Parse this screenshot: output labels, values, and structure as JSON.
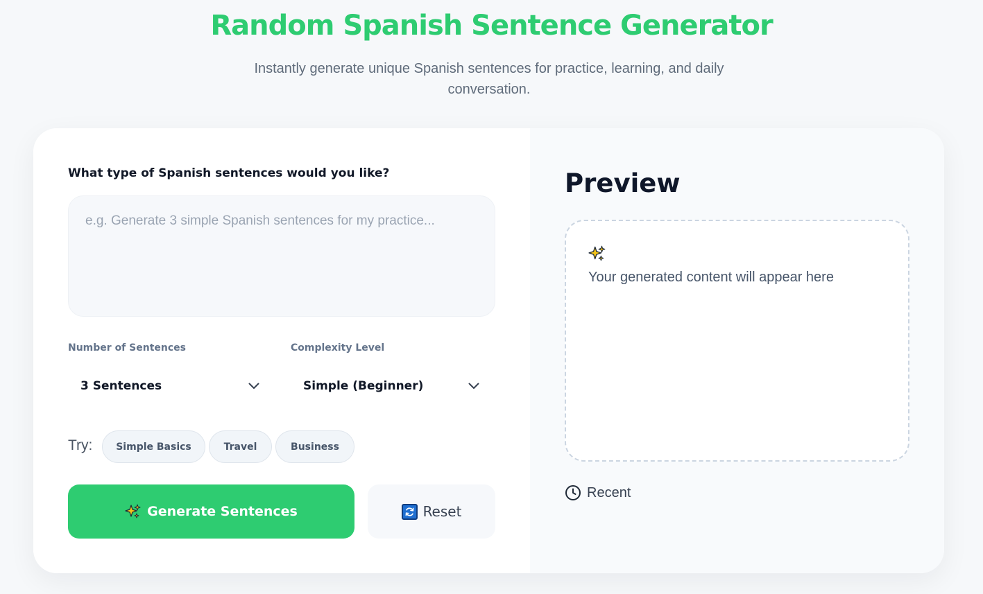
{
  "header": {
    "title": "Random Spanish Sentence Generator",
    "subtitle": "Instantly generate unique Spanish sentences for practice, learning, and daily conversation."
  },
  "form": {
    "question_label": "What type of Spanish sentences would you like?",
    "prompt_placeholder": "e.g. Generate 3 simple Spanish sentences for my practice...",
    "prompt_value": "",
    "count_label": "Number of Sentences",
    "count_value": "3 Sentences",
    "complexity_label": "Complexity Level",
    "complexity_value": "Simple (Beginner)",
    "try_label": "Try:",
    "chips": [
      "Simple Basics",
      "Travel",
      "Business"
    ],
    "generate_label": "Generate Sentences",
    "reset_label": "Reset"
  },
  "preview": {
    "title": "Preview",
    "empty_text": "Your generated content will appear here",
    "recent_label": "Recent"
  },
  "icons": {
    "generate": "sparkles-icon",
    "reset": "refresh-icon",
    "preview_empty": "sparkles-icon",
    "recent": "clock-icon",
    "select": "chevron-down-icon"
  },
  "colors": {
    "accent": "#2ecc71",
    "reset_icon": "#1f6fd1",
    "sparkle": "#f5c518"
  }
}
